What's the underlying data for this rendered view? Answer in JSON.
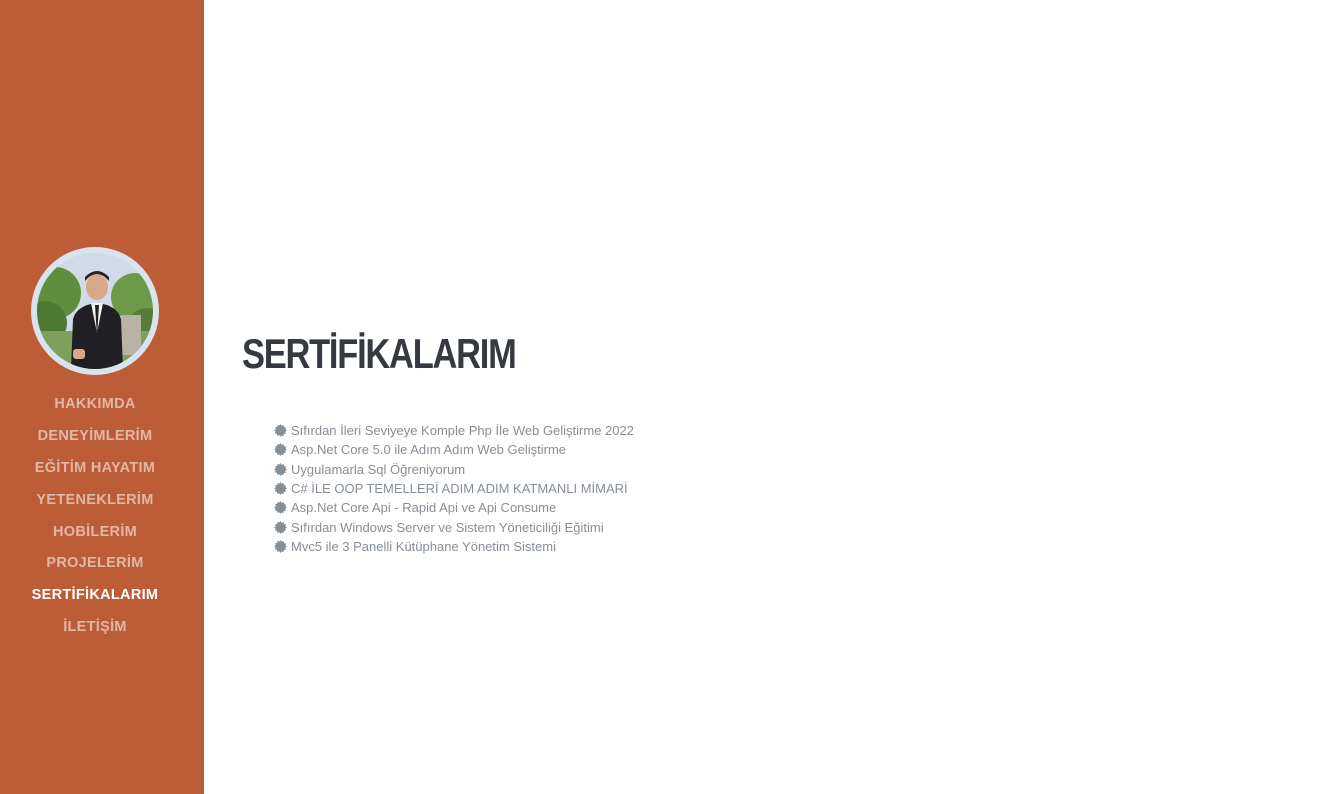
{
  "sidebar": {
    "avatar_alt": "profile photo",
    "nav": [
      {
        "label": "HAKKIMDA"
      },
      {
        "label": "DENEYİMLERİM"
      },
      {
        "label": "EĞİTİM HAYATIM"
      },
      {
        "label": "YETENEKLERİM"
      },
      {
        "label": "HOBİLERİM"
      },
      {
        "label": "PROJELERİM"
      },
      {
        "label": "SERTİFİKALARIM"
      },
      {
        "label": "İLETİŞİM"
      }
    ],
    "active_index": 6
  },
  "main": {
    "title": "SERTİFİKALARIM",
    "certificates": [
      {
        "icon": "certificate-icon",
        "text": "Sıfırdan İleri Seviyeye Komple Php İle Web Geliştirme 2022"
      },
      {
        "icon": "certificate-icon",
        "text": "Asp.Net Core 5.0 ile Adım Adım Web Geliştirme"
      },
      {
        "icon": "certificate-icon",
        "text": "Uygulamarla Sql Öğreniyorum"
      },
      {
        "icon": "certificate-icon",
        "text": "C# İLE OOP TEMELLERİ ADIM ADIM KATMANLI MİMARİ"
      },
      {
        "icon": "certificate-icon",
        "text": "Asp.Net Core Api - Rapid Api ve Api Consume"
      },
      {
        "icon": "certificate-icon",
        "text": "Sıfırdan Windows Server ve Sistem Yöneticiliği Eğitimi"
      },
      {
        "icon": "certificate-icon",
        "text": "Mvc5 ile 3 Panelli Kütüphane Yönetim Sistemi"
      }
    ]
  },
  "colors": {
    "sidebar_bg": "#bd5d38",
    "nav_text": "#f0c9b8",
    "nav_active": "#ffffff",
    "title": "#343a40",
    "body_text": "#868e96"
  }
}
